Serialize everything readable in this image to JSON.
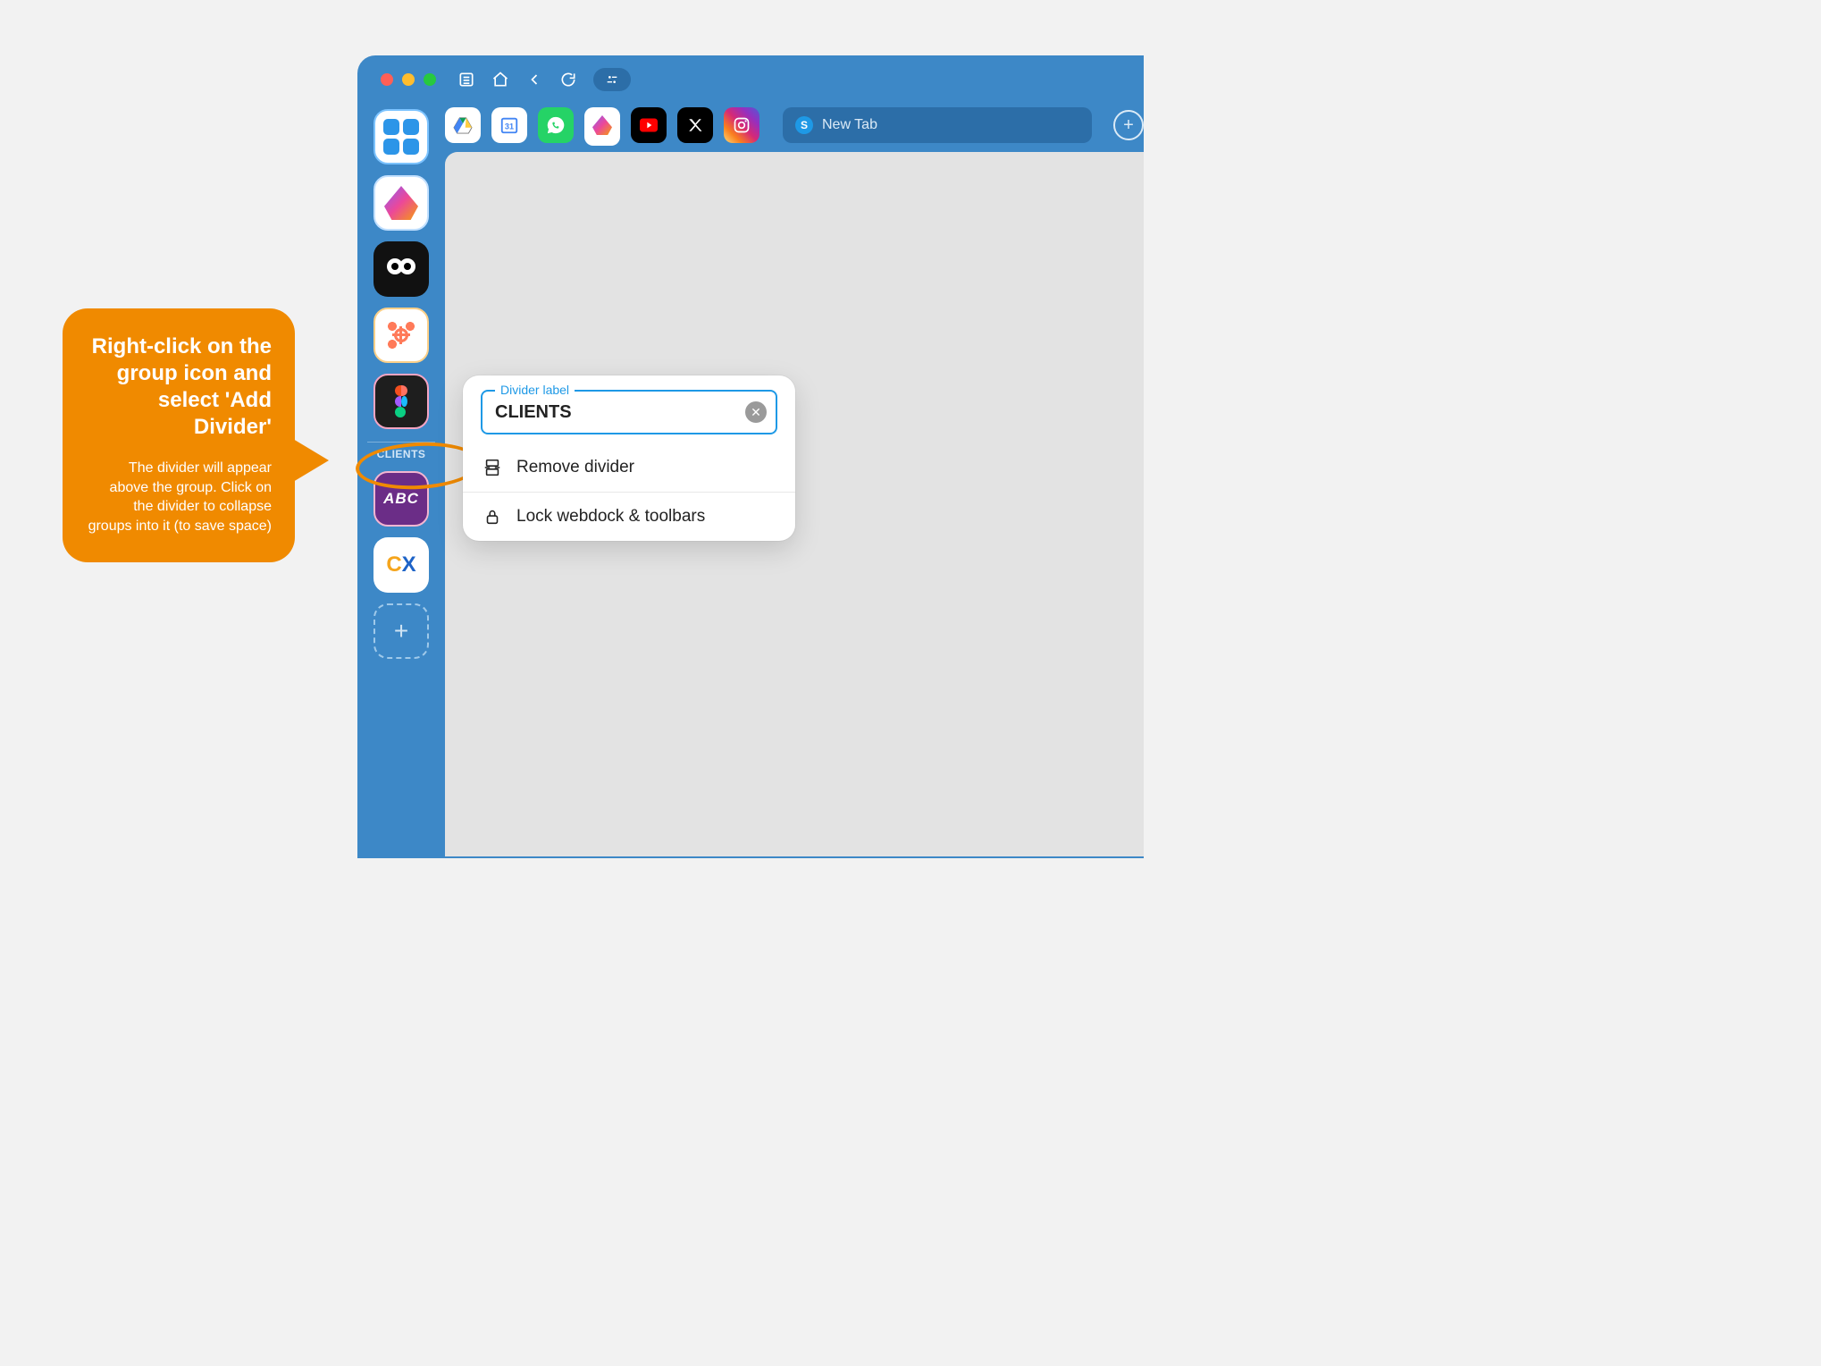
{
  "callout": {
    "headline": "Right-click on the group icon and select 'Add Divider'",
    "body": "The divider will appear above the group. Click on the divider to collapse groups into it (to save space)"
  },
  "titlebar": {
    "nav": [
      "list",
      "home",
      "back",
      "reload",
      "tune"
    ]
  },
  "tabstrip": {
    "newtab_label": "New Tab"
  },
  "webdock": {
    "divider_label": "CLIENTS",
    "abc_label": "ABC"
  },
  "popover": {
    "field_label": "Divider label",
    "field_value": "CLIENTS",
    "remove_label": "Remove divider",
    "lock_label": "Lock webdock & toolbars"
  }
}
